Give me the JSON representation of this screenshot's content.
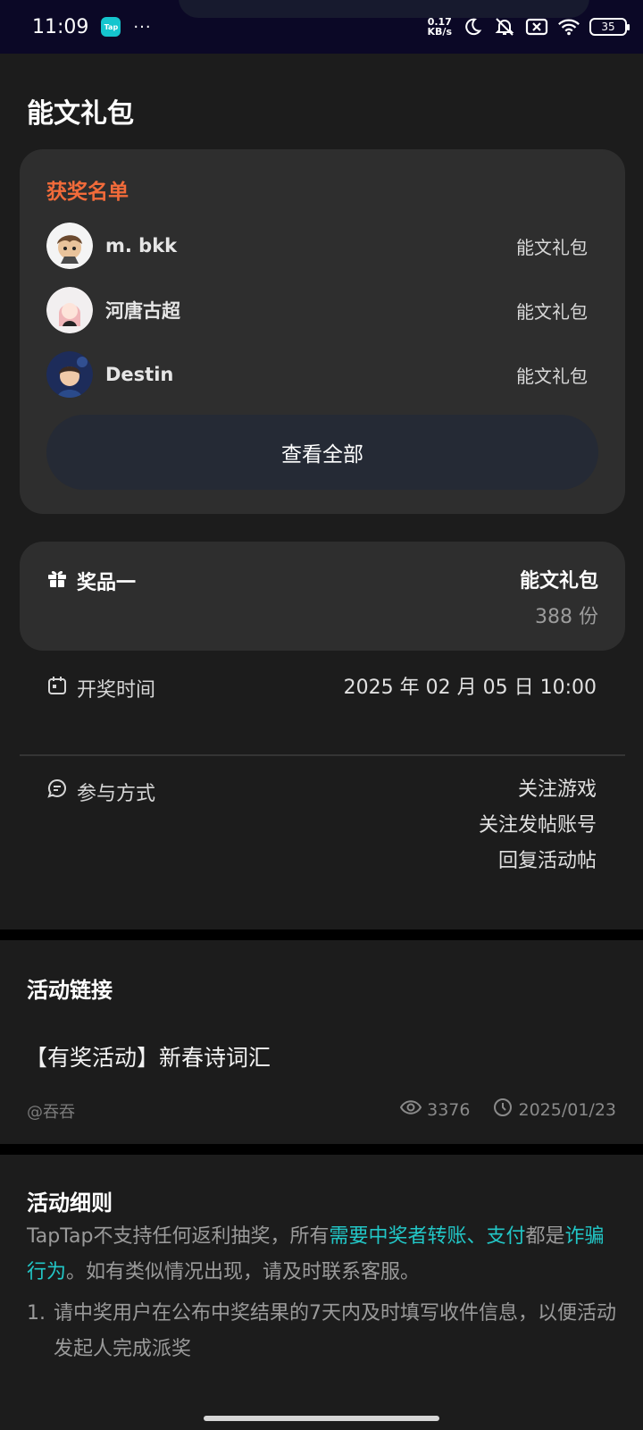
{
  "status_bar": {
    "time": "11:09",
    "app_badge": "Tap",
    "dots": "···",
    "speed_value": "0.17",
    "speed_unit": "KB/s",
    "battery": "35"
  },
  "page": {
    "title": "能文礼包"
  },
  "winners": {
    "title": "获奖名单",
    "items": [
      {
        "name": "m. bkk",
        "prize": "能文礼包"
      },
      {
        "name": "河唐古超",
        "prize": "能文礼包"
      },
      {
        "name": "Destin",
        "prize": "能文礼包"
      }
    ],
    "view_all_label": "查看全部"
  },
  "prize": {
    "label": "奖品一",
    "name": "能文礼包",
    "count": "388 份"
  },
  "draw_time": {
    "label": "开奖时间",
    "value": "2025 年 02 月 05 日 10:00"
  },
  "participation": {
    "label": "参与方式",
    "methods": [
      "关注游戏",
      "关注发帖账号",
      "回复活动帖"
    ]
  },
  "activity_link": {
    "title": "活动链接",
    "post_title": "【有奖活动】新春诗词汇",
    "author": "@吞吞",
    "views": "3376",
    "date": "2025/01/23"
  },
  "rules": {
    "title": "活动细则",
    "intro_1": "TapTap不支持任何返利抽奖，所有",
    "intro_hl_1": "需要中奖者转账、支付",
    "intro_2": "都是",
    "intro_hl_2": "诈骗行为",
    "intro_3": "。如有类似情况出现，请及时联系客服。",
    "item_1_num": "1.",
    "item_1_text": "请中奖用户在公布中奖结果的7天内及时填写收件信息，以便活动发起人完成派奖"
  },
  "colors": {
    "accent_orange": "#f26b3a",
    "accent_teal": "#22c7c7"
  }
}
